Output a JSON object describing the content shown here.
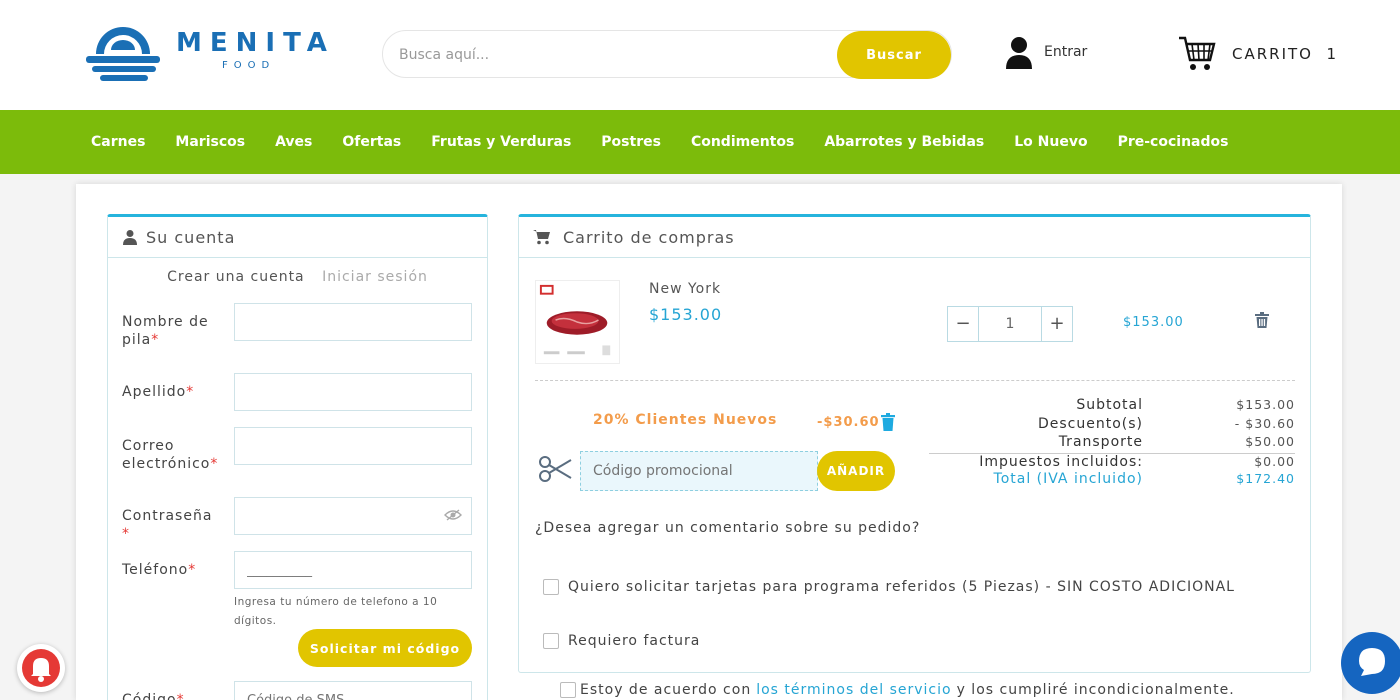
{
  "brand": {
    "name": "MENITA",
    "sub": "FOOD"
  },
  "search": {
    "placeholder": "Busca aquí...",
    "button": "Buscar"
  },
  "header": {
    "login": "Entrar",
    "cart_label": "CARRITO",
    "cart_count": "1"
  },
  "nav": {
    "items": [
      "Carnes",
      "Mariscos",
      "Aves",
      "Ofertas",
      "Frutas y Verduras",
      "Postres",
      "Condimentos",
      "Abarrotes y Bebidas",
      "Lo Nuevo",
      "Pre-cocinados"
    ]
  },
  "account": {
    "title": "Su cuenta",
    "tab_create": "Crear una cuenta",
    "tab_login": "Iniciar sesión",
    "first_name": "Nombre de pila",
    "last_name": "Apellido",
    "email": "Correo electrónico",
    "password": "Contraseña",
    "phone": "Teléfono",
    "phone_placeholder": "__________",
    "phone_hint": "Ingresa tu número de telefono a 10 dígitos.",
    "code_button": "Solicitar mi código",
    "code_label": "Código",
    "code_placeholder": "Código de SMS",
    "required_mark": "*"
  },
  "cart": {
    "title": "Carrito de compras",
    "product": {
      "name": "New York",
      "price": "$153.00",
      "qty": "1",
      "line_total": "$153.00"
    },
    "promo": {
      "name": "20% Clientes Nuevos",
      "amount": "-$30.60",
      "placeholder": "Código promocional",
      "button": "AÑADIR"
    },
    "totals": [
      {
        "label": "Subtotal",
        "value": "$153.00"
      },
      {
        "label": "Descuento(s)",
        "value": "- $30.60"
      },
      {
        "label": "Transporte",
        "value": "$50.00"
      },
      {
        "label": "Impuestos incluidos:",
        "value": "$0.00"
      },
      {
        "label": "Total (IVA incluido)",
        "value": "$172.40"
      }
    ],
    "comment_prompt": "¿Desea agregar un comentario sobre su pedido?",
    "check_referrals": "Quiero solicitar tarjetas para programa referidos (5 Piezas) - SIN COSTO ADICIONAL",
    "check_invoice": "Requiero factura"
  },
  "terms": {
    "pre": "Estoy de acuerdo con",
    "link": "los términos del servicio",
    "post": "y los cumpliré incondicionalmente."
  },
  "colors": {
    "nav": "#7cbb0b",
    "accent": "#e1c500",
    "brand_blue": "#1a6fb5",
    "link": "#26a5d4",
    "promo": "#f39c4b"
  }
}
